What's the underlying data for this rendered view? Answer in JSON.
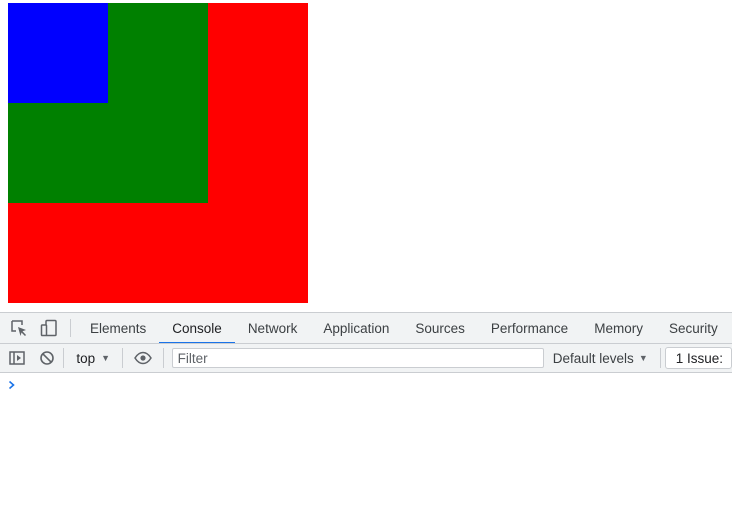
{
  "page": {
    "squares": [
      {
        "name": "red-square",
        "color": "#ff0000"
      },
      {
        "name": "green-square",
        "color": "#008000"
      },
      {
        "name": "blue-square",
        "color": "#0000ff"
      }
    ]
  },
  "devtools": {
    "icons": [
      "inspect-element-icon",
      "device-toolbar-icon"
    ],
    "tabs": [
      {
        "label": "Elements",
        "active": false
      },
      {
        "label": "Console",
        "active": true
      },
      {
        "label": "Network",
        "active": false
      },
      {
        "label": "Application",
        "active": false
      },
      {
        "label": "Sources",
        "active": false
      },
      {
        "label": "Performance",
        "active": false
      },
      {
        "label": "Memory",
        "active": false
      },
      {
        "label": "Security",
        "active": false
      }
    ],
    "accent_color": "#1a73e8",
    "toolbar": {
      "icons": [
        "sidebar-toggle-icon",
        "clear-console-icon",
        "eye-icon"
      ],
      "context": "top",
      "filter_placeholder": "Filter",
      "levels": "Default levels",
      "issues": "1 Issue:"
    },
    "console": {
      "prompt_icon": "chevron-right-icon"
    }
  }
}
